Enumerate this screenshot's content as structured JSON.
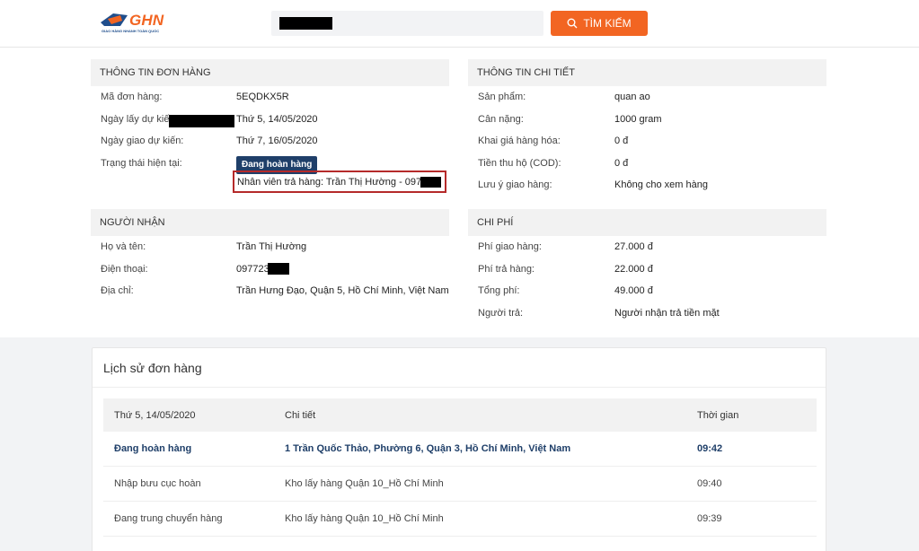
{
  "header": {
    "logo_text": "GHN",
    "logo_tagline": "GIAO HÀNG NHANH TOÀN QUỐC",
    "search_value": "",
    "search_button_label": "TÌM KIẾM"
  },
  "order_info": {
    "title": "THÔNG TIN ĐƠN HÀNG",
    "rows": [
      {
        "label": "Mã đơn hàng:",
        "value": "5EQDKX5R"
      },
      {
        "label": "Ngày lấy dự kiến",
        "value": "Thứ 5, 14/05/2020"
      },
      {
        "label": "Ngày giao dự kiến:",
        "value": "Thứ 7, 16/05/2020"
      },
      {
        "label": "Trạng thái hiện tại:",
        "value": ""
      }
    ],
    "status_badge": "Đang hoàn hàng",
    "staff_text": "Nhân viên trả hàng: Trần Thị Hường - 097723"
  },
  "detail_info": {
    "title": "THÔNG TIN CHI TIẾT",
    "rows": [
      {
        "label": "Sản phẩm:",
        "value": "quan ao"
      },
      {
        "label": "Cân nặng:",
        "value": "1000 gram"
      },
      {
        "label": "Khai giá hàng hóa:",
        "value": "0 đ"
      },
      {
        "label": "Tiền thu hộ (COD):",
        "value": "0 đ"
      },
      {
        "label": "Lưu ý giao hàng:",
        "value": "Không cho xem hàng"
      }
    ]
  },
  "receiver": {
    "title": "NGƯỜI NHẬN",
    "rows": [
      {
        "label": "Họ và tên:",
        "value": "Trần Thị Hường"
      },
      {
        "label": "Điện thoại:",
        "value": "097723"
      },
      {
        "label": "Địa chỉ:",
        "value": "Trần Hưng Đạo, Quận 5, Hồ Chí Minh, Việt Nam"
      }
    ]
  },
  "fees": {
    "title": "CHI PHÍ",
    "rows": [
      {
        "label": "Phí giao hàng:",
        "value": "27.000 đ"
      },
      {
        "label": "Phí trả hàng:",
        "value": "22.000 đ"
      },
      {
        "label": "Tổng phí:",
        "value": "49.000 đ"
      },
      {
        "label": "Người trả:",
        "value": "Người nhận trả tiền mặt"
      }
    ]
  },
  "history": {
    "title": "Lịch sử đơn hàng",
    "columns": [
      "Thứ 5, 14/05/2020",
      "Chi tiết",
      "Thời gian"
    ],
    "rows": [
      {
        "status": "Đang hoàn hàng",
        "detail": "1 Trần Quốc Thảo, Phường 6, Quận 3, Hồ Chí Minh, Việt Nam",
        "time": "09:42"
      },
      {
        "status": "Nhập bưu cục hoàn",
        "detail": "Kho lấy hàng Quận 10_Hồ Chí Minh",
        "time": "09:40"
      },
      {
        "status": "Đang trung chuyển hàng",
        "detail": "Kho lấy hàng Quận 10_Hồ Chí Minh",
        "time": "09:39"
      }
    ]
  },
  "colors": {
    "brand_orange": "#f26522",
    "brand_navy": "#1f3f69",
    "highlight_border": "#b52a2a"
  }
}
